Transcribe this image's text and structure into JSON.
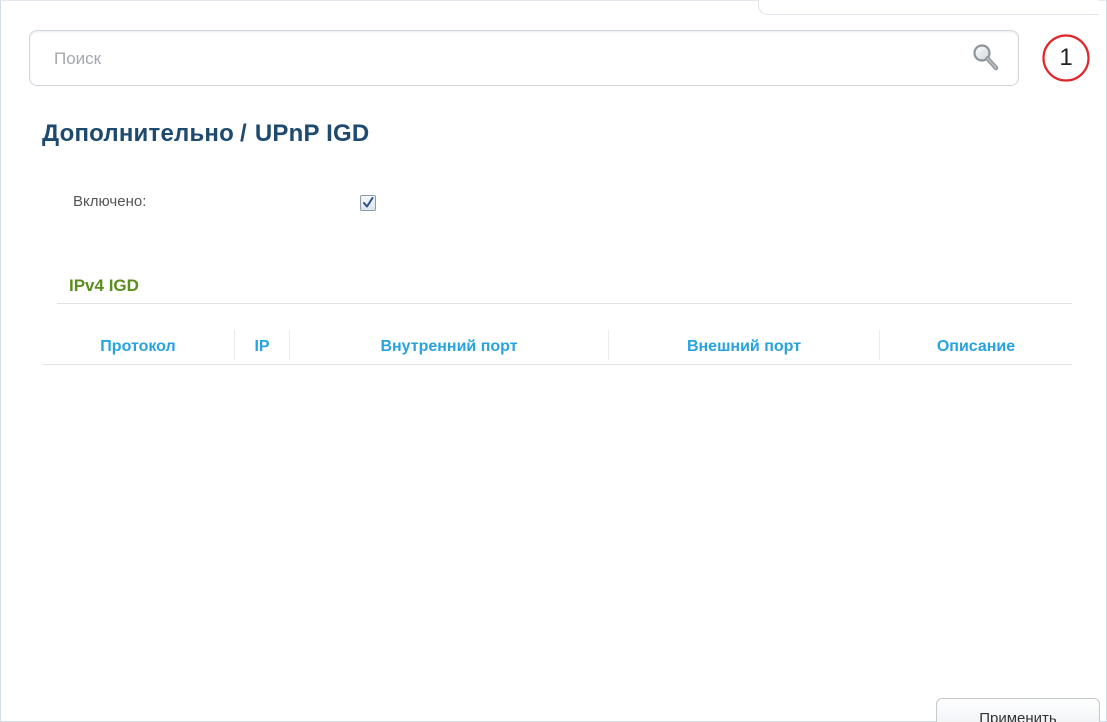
{
  "search": {
    "placeholder": "Поиск",
    "value": ""
  },
  "badge": {
    "number": "1",
    "color": "#e0262b"
  },
  "breadcrumb": {
    "parent": "Дополнительно",
    "separator": "/",
    "current": "UPnP IGD"
  },
  "settings": {
    "enabled_label": "Включено:",
    "enabled_checked": true
  },
  "section": {
    "title": "IPv4 IGD"
  },
  "table": {
    "columns": [
      "Протокол",
      "IP",
      "Внутренний порт",
      "Внешний порт",
      "Описание"
    ],
    "rows": []
  },
  "actions": {
    "apply_label": "Применить"
  },
  "colors": {
    "title": "#1d4a6e",
    "section": "#5b8d1f",
    "table_header": "#27a3df"
  }
}
